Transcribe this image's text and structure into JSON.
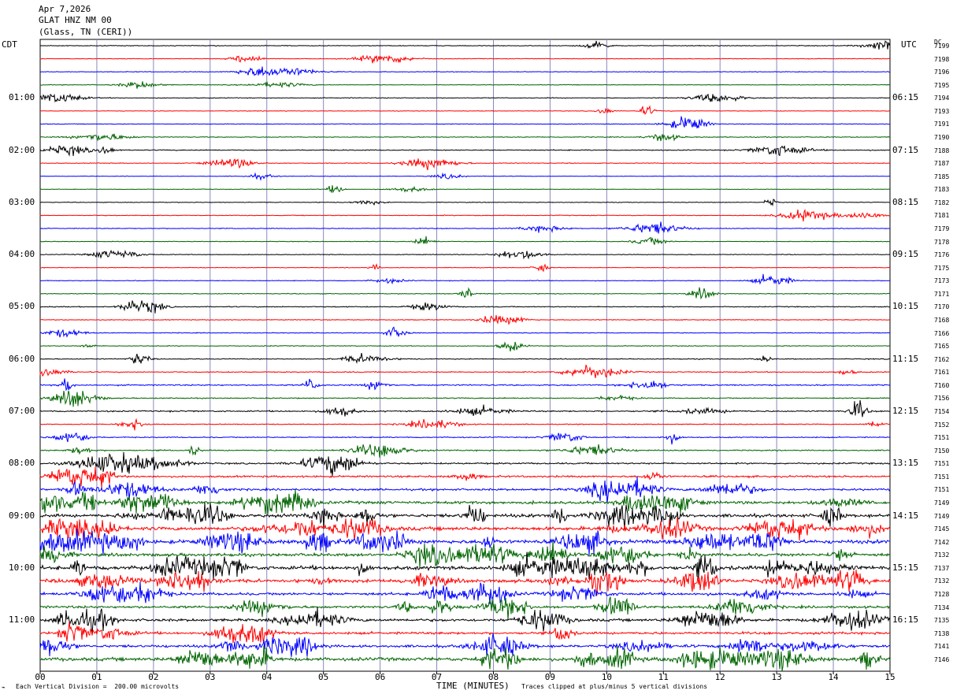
{
  "header": {
    "date": "Apr 7,2026",
    "station": "GLAT HNZ NM 00",
    "location": "(Glass, TN (CERI))"
  },
  "left_label": "CDT",
  "right_label": "UTC",
  "dc_label": "DC",
  "footer": {
    "scale_note": "Each Vertical Division =  200.00 microvolts",
    "xlabel": "TIME (MINUTES)",
    "clip_note": "Traces clipped at plus/minus 5 vertical divisions"
  },
  "chart_data": {
    "type": "line",
    "title": "GLAT HNZ NM 00",
    "xlabel": "TIME (MINUTES)",
    "xlim": [
      0,
      15
    ],
    "x_ticks": [
      "00",
      "01",
      "02",
      "03",
      "04",
      "05",
      "06",
      "07",
      "08",
      "09",
      "10",
      "11",
      "12",
      "13",
      "14",
      "15"
    ],
    "trace_colors": [
      "#000000",
      "#ff0000",
      "#0000ff",
      "#006400"
    ],
    "left_times": [
      "01:00",
      "02:00",
      "03:00",
      "04:00",
      "05:00",
      "06:00",
      "07:00",
      "08:00",
      "09:00",
      "10:00",
      "11:00"
    ],
    "right_times": [
      "06:15",
      "07:15",
      "08:15",
      "09:15",
      "10:15",
      "11:15",
      "12:15",
      "13:15",
      "14:15",
      "15:15",
      "16:15"
    ],
    "dc_offsets": [
      "7199",
      "7198",
      "7196",
      "7195",
      "7194",
      "7193",
      "7191",
      "7190",
      "7188",
      "7187",
      "7185",
      "7183",
      "7182",
      "7181",
      "7179",
      "7178",
      "7176",
      "7175",
      "7173",
      "7171",
      "7170",
      "7168",
      "7166",
      "7165",
      "7162",
      "7161",
      "7160",
      "7156",
      "7154",
      "7152",
      "7151",
      "7150",
      "7151",
      "7151",
      "7151",
      "7149",
      "7149",
      "7145",
      "7142",
      "7132",
      "7137",
      "7132",
      "7128",
      "7134",
      "7135",
      "7138",
      "7141",
      "7146"
    ],
    "trace_activity": [
      1,
      0.9,
      0.9,
      0.9,
      1.1,
      0.8,
      0.9,
      1.1,
      1.3,
      1,
      0.8,
      0.8,
      0.9,
      1,
      1,
      0.8,
      0.9,
      0.9,
      1,
      1.1,
      1.3,
      1,
      1,
      1.1,
      1.2,
      1.4,
      1.8,
      1.4,
      1.9,
      1.2,
      1.4,
      1.6,
      2.2,
      2.6,
      2.8,
      4,
      4.5,
      5,
      5.3,
      4.2,
      5.5,
      4.5,
      3.6,
      3.4,
      3.8,
      3.4,
      3.6,
      4.8
    ],
    "units_per_division": "200.00 microvolts",
    "clip_divisions": 5
  }
}
